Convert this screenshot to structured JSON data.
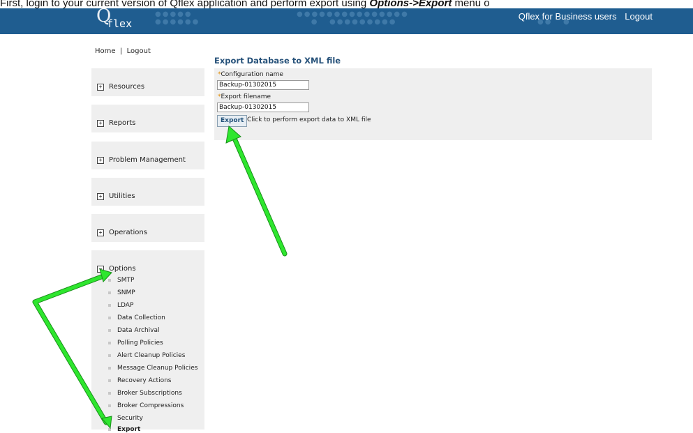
{
  "caption": {
    "prefix": "First, login to your current version of Qflex application and perform export using ",
    "path": "Options->Export",
    "suffix": " menu o"
  },
  "header": {
    "logo_q": "Q",
    "logo_flex": "flex",
    "nav": [
      "Qflex for Business users",
      "Logout"
    ]
  },
  "home_nav": {
    "home": "Home",
    "separator": "|",
    "logout": "Logout"
  },
  "sidebar": {
    "sections": [
      {
        "label": "Resources",
        "toggle": "+"
      },
      {
        "label": "Reports",
        "toggle": "+"
      },
      {
        "label": "Problem Management",
        "toggle": "+"
      },
      {
        "label": "Utilities",
        "toggle": "+"
      },
      {
        "label": "Operations",
        "toggle": "+"
      },
      {
        "label": "Options",
        "toggle": "−",
        "items": [
          "SMTP",
          "SNMP",
          "LDAP",
          "Data Collection",
          "Data Archival",
          "Polling Policies",
          "Alert Cleanup Policies",
          "Message Cleanup Policies",
          "Recovery Actions",
          "Broker Subscriptions",
          "Broker Compressions",
          "Security",
          "Export"
        ]
      }
    ]
  },
  "main": {
    "title": "Export Database to XML file",
    "config_label": "Configuration name",
    "config_value": "Backup-01302015",
    "filename_label": "Export filename",
    "filename_value": "Backup-01302015",
    "required_marker": "*",
    "export_button": "Export",
    "export_hint": "Click to perform export data to XML file"
  },
  "colors": {
    "header_bg": "#1f5d90",
    "title": "#27527a",
    "arrow": "#2ee62e",
    "required": "#e08a00"
  }
}
